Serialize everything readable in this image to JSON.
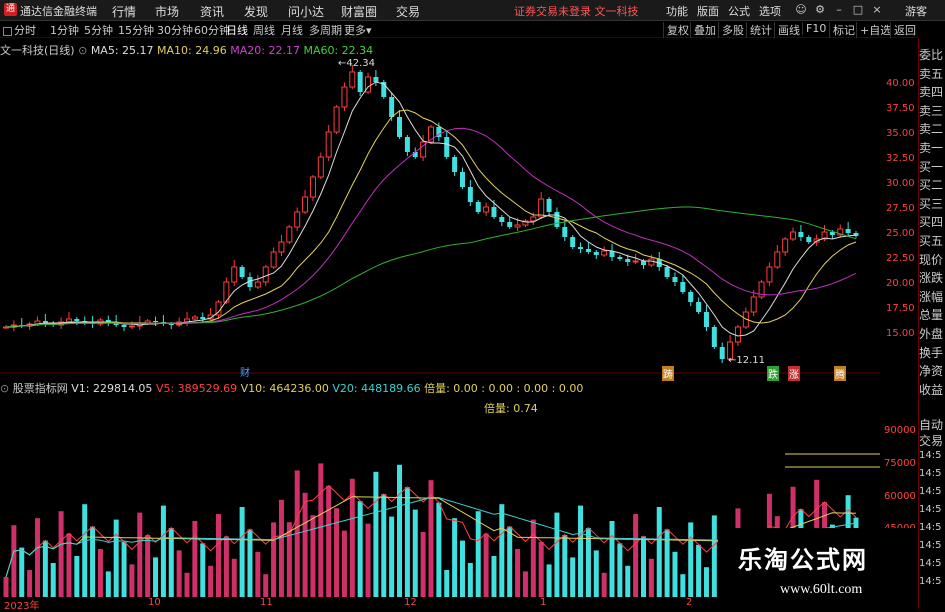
{
  "titlebar": {
    "app_title": "通达信金融终端",
    "menus": [
      "行情",
      "市场",
      "资讯",
      "发现",
      "问小达",
      "财富圈",
      "交易"
    ],
    "center_text": "证券交易未登录  文一科技",
    "right_menus": [
      "功能",
      "版面",
      "公式",
      "选项"
    ],
    "guest": "游客"
  },
  "periodbar": {
    "periods": [
      "分时",
      "1分钟",
      "5分钟",
      "15分钟",
      "30分钟",
      "60分钟",
      "日线",
      "周线",
      "月线",
      "多周期",
      "更多"
    ],
    "active": "日线",
    "tools": [
      "复权",
      "叠加",
      "多股",
      "统计",
      "画线",
      "F10",
      "标记",
      "+自选",
      "返回"
    ]
  },
  "malegend": {
    "stock": "文一科技(日线)",
    "ma5": "MA5: 25.17",
    "ma10": "MA10: 24.96",
    "ma20": "MA20: 22.17",
    "ma60": "MA60: 22.34"
  },
  "price_axis": [
    "40.00",
    "37.50",
    "35.00",
    "32.50",
    "30.00",
    "27.50",
    "25.00",
    "22.50",
    "20.00",
    "17.50",
    "15.00"
  ],
  "annotations": {
    "high": "42.34",
    "low": "12.11",
    "cai": "财",
    "events": [
      "踌",
      "跌",
      "涨",
      "腾"
    ]
  },
  "vollegend": {
    "name": "股票指标网",
    "v1": "V1: 229814.05",
    "v5": "V5: 389529.69",
    "v10": "V10: 464236.00",
    "v20": "V20: 448189.66",
    "ratio_label": "倍量: 0.00 : 0.00 : 0.00 : 0.00",
    "ratio_mid": "倍量: 0.74"
  },
  "vol_axis": [
    "90000",
    "75000",
    "60000",
    "45000"
  ],
  "date_axis": [
    "2023年",
    "10",
    "11",
    "12",
    "1",
    "2"
  ],
  "right_panel": {
    "items": [
      "委比",
      "卖五",
      "卖四",
      "卖三",
      "卖二",
      "卖一",
      "买一",
      "买二",
      "买三",
      "买四",
      "买五",
      "现价",
      "涨跌",
      "涨幅",
      "总量",
      "外盘",
      "换手",
      "净资",
      "收益"
    ],
    "lower": [
      "自动",
      "交易"
    ],
    "times": [
      "14:5",
      "14:5",
      "14:5",
      "14:5",
      "14:5",
      "14:5",
      "14:5",
      "14:5"
    ]
  },
  "watermark": {
    "title": "乐淘公式网",
    "url": "www.60lt.com"
  },
  "chart_data": {
    "type": "candlestick",
    "ylim": [
      12,
      43
    ],
    "close": [
      16,
      16.2,
      16.1,
      16.3,
      16.6,
      16.4,
      16.2,
      16.5,
      16.8,
      16.6,
      16.4,
      16.3,
      16.7,
      16.5,
      16.2,
      16,
      16.1,
      16.4,
      16.6,
      16.5,
      16.3,
      16.2,
      16.5,
      16.8,
      17,
      16.8,
      17.2,
      18.5,
      20.5,
      22,
      21,
      20,
      20.5,
      22,
      23.5,
      24.5,
      26,
      27.5,
      29,
      31,
      33,
      35.5,
      38,
      40,
      41.5,
      39.5,
      41,
      40.5,
      39,
      37,
      35,
      33.5,
      33,
      34.5,
      36,
      35,
      33,
      31.5,
      30,
      28.5,
      27.5,
      28,
      27,
      26.5,
      26,
      26.2,
      26.6,
      27,
      28.8,
      27.5,
      26,
      25,
      24,
      23.8,
      23.5,
      23.2,
      23.6,
      23,
      22.8,
      22.5,
      22.6,
      22.2,
      22.8,
      22,
      21,
      20.5,
      19.5,
      18.5,
      17.5,
      16,
      14,
      12.8,
      14.5,
      16,
      17.5,
      19,
      20.5,
      22,
      23.5,
      24.8,
      25.5,
      25,
      24.5,
      24.8,
      25.5,
      25.2,
      25.8,
      25.4,
      25.1
    ],
    "ma5": [
      16,
      16.1,
      16.1,
      16.2,
      16.3,
      16.4,
      16.4,
      16.4,
      16.5,
      16.5,
      16.5,
      16.5,
      16.5,
      16.5,
      16.4,
      16.3,
      16.3,
      16.2,
      16.3,
      16.3,
      16.4,
      16.4,
      16.4,
      16.5,
      16.6,
      16.7,
      16.9,
      17.5,
      18.6,
      19.6,
      20.2,
      20.6,
      20.8,
      21.1,
      21.4,
      22.1,
      23.3,
      24.7,
      26.1,
      27.6,
      29.3,
      31.2,
      33.5,
      35.5,
      37.6,
      38.9,
      40,
      40.5,
      40.3,
      39.4,
      38.5,
      37,
      35.7,
      34.6,
      34.4,
      34.4,
      34.3,
      34,
      33.1,
      31.6,
      30.1,
      29.1,
      28.4,
      27.7,
      27,
      26.7,
      26.5,
      26.5,
      26.9,
      27.2,
      27.2,
      26.9,
      26.1,
      25.1,
      24.5,
      24,
      23.7,
      23.6,
      23.4,
      23.1,
      22.9,
      22.6,
      22.6,
      22.4,
      22.1,
      21.7,
      21.2,
      20.3,
      19.4,
      18.3,
      17.2,
      16,
      15.4,
      15.1,
      15.2,
      15.6,
      16.7,
      17.8,
      19.1,
      20.4,
      21.8,
      22.9,
      23.9,
      24.6,
      24.9,
      24.8,
      25,
      25.1,
      25.2
    ],
    "ma10": [
      16,
      16,
      16.1,
      16.1,
      16.2,
      16.3,
      16.3,
      16.3,
      16.4,
      16.4,
      16.4,
      16.4,
      16.4,
      16.5,
      16.5,
      16.4,
      16.4,
      16.4,
      16.4,
      16.4,
      16.4,
      16.4,
      16.3,
      16.4,
      16.4,
      16.5,
      16.6,
      16.9,
      17.4,
      18,
      18.4,
      18.7,
      19,
      19.3,
      19.7,
      20.1,
      20.9,
      21.9,
      22.7,
      23.5,
      24.4,
      25.5,
      27,
      28.6,
      30.2,
      31.7,
      33.3,
      34.7,
      35.9,
      37,
      37.6,
      37.7,
      37.4,
      36.9,
      36.6,
      36.1,
      35.6,
      35,
      34.2,
      33,
      31.8,
      30.9,
      30.1,
      29.4,
      28.8,
      28.2,
      27.6,
      27.2,
      27.2,
      27.1,
      26.9,
      26.7,
      26.5,
      26.1,
      25.7,
      25.4,
      24.9,
      24.5,
      24.1,
      23.8,
      23.6,
      23.2,
      23,
      22.8,
      22.5,
      22.2,
      21.8,
      21.4,
      20.9,
      20.3,
      19.4,
      18.6,
      17.9,
      17.3,
      16.8,
      16.5,
      16.4,
      16.5,
      16.8,
      17.2,
      17.9,
      18.8,
      20.1,
      21.3,
      22.3,
      23.1,
      23.7,
      24.2,
      24.5
    ]
  }
}
